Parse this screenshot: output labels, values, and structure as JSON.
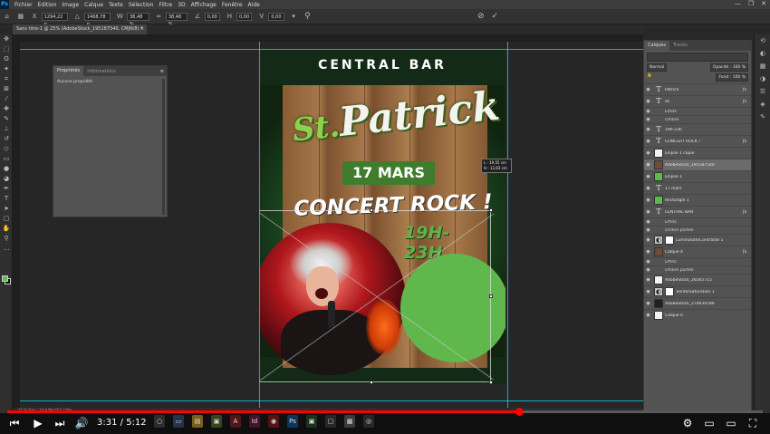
{
  "menubar": {
    "logo": "Ps",
    "items": [
      "Fichier",
      "Edition",
      "Image",
      "Calque",
      "Texte",
      "Sélection",
      "Filtre",
      "3D",
      "Affichage",
      "Fenêtre",
      "Aide"
    ],
    "controls": [
      "—",
      "❐",
      "✕"
    ]
  },
  "options": {
    "x": "1294,22 p",
    "y": "1468,78 p",
    "w": "38,48 %",
    "h": "38,48 %",
    "angle": "0,00",
    "h_skew": "0,00",
    "v_skew": "0,00"
  },
  "document_tab": {
    "title": "Sans titre-1 @ 25% (AdobeStock_195187540, CMJN/8) *",
    "close": "×"
  },
  "properties_panel": {
    "tab_active": "Propriétés",
    "tab_inactive": "Informations",
    "body": "Aucune propriété"
  },
  "poster": {
    "header": "CENTRAL BAR",
    "title_st": "St.",
    "title_name": "Patrick",
    "date": "17 MARS",
    "concert": "CONCERT ROCK !",
    "hours": "19H-23H"
  },
  "dimension_tooltip": {
    "l": "L : 19,55 cm",
    "h": "H : 12,83 cm"
  },
  "layers_panel": {
    "tab_active": "Calques",
    "tab_inactive": "Tracés",
    "blend_mode": "Normal",
    "opacity": "Opacité : 100 %",
    "fill": "Fond : 100 %",
    "rows": [
      {
        "kind": "text",
        "name": "Patrick",
        "fx": true
      },
      {
        "kind": "text",
        "name": "St.",
        "fx": true
      },
      {
        "kind": "effect",
        "name": "Effets"
      },
      {
        "kind": "effect",
        "name": "Ombre"
      },
      {
        "kind": "text",
        "name": "19h-23h",
        "fx": false
      },
      {
        "kind": "text",
        "name": "CONCERT ROCK !",
        "fx": true
      },
      {
        "kind": "white",
        "name": "Ellipse 1 copie",
        "fx": false
      },
      {
        "kind": "img",
        "name": "AdobeStock_195187540",
        "fx": false,
        "selected": true
      },
      {
        "kind": "green",
        "name": "Ellipse 1",
        "fx": false
      },
      {
        "kind": "text",
        "name": "17 mars",
        "fx": false
      },
      {
        "kind": "green",
        "name": "Rectangle 1",
        "fx": false
      },
      {
        "kind": "text",
        "name": "CENTRAL BAR",
        "fx": true
      },
      {
        "kind": "effect",
        "name": "Effets"
      },
      {
        "kind": "effect",
        "name": "Ombre portée"
      },
      {
        "kind": "adjust",
        "name": "Luminosité/Contraste 1",
        "fx": false
      },
      {
        "kind": "img",
        "name": "Calque 4",
        "fx": true
      },
      {
        "kind": "effect",
        "name": "Effets"
      },
      {
        "kind": "effect",
        "name": "Ombre portée"
      },
      {
        "kind": "white",
        "name": "AdobeStock_26565715",
        "fx": false
      },
      {
        "kind": "adjust",
        "name": "Teinte/Saturation 1",
        "fx": false
      },
      {
        "kind": "dark",
        "name": "AdobeStock_270639786",
        "fx": false
      },
      {
        "kind": "white",
        "name": "Calque 0",
        "fx": false
      }
    ]
  },
  "statusbar": {
    "text": "25 %      Doc : 34,6 Mo/253,7 Mo"
  },
  "video": {
    "current_time": "3:31",
    "duration": "5:12",
    "time_sep": " / ",
    "progress": 0.677
  },
  "colors": {
    "accent_green": "#5fb84b",
    "youtube_red": "#ff0000",
    "guide_cyan": "#00d8e0"
  }
}
